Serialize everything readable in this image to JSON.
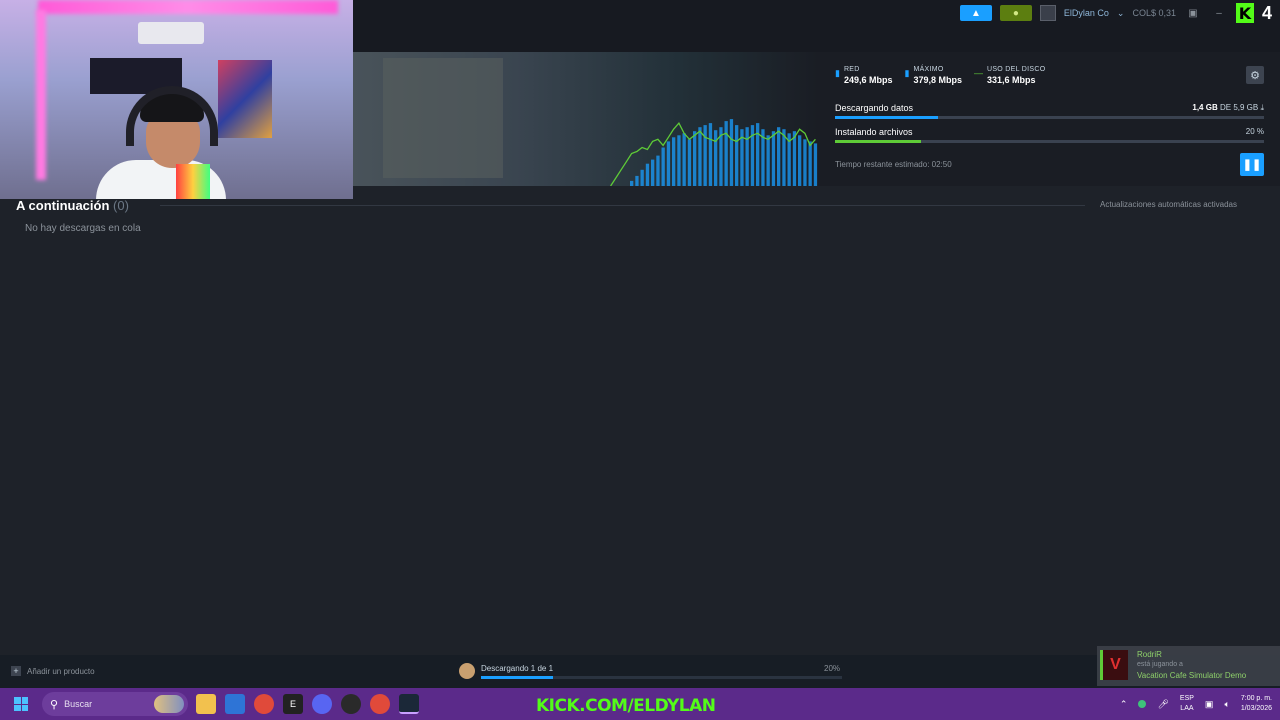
{
  "topbar": {
    "account_name": "ElDylan Co",
    "account_balance": "COL$ 0,31",
    "kick_logo": "K",
    "kick_number": "4"
  },
  "download": {
    "stats": [
      {
        "label": "RED",
        "value": "249,6 Mbps",
        "icon": "network-bars-icon",
        "color": "#1a9fff"
      },
      {
        "label": "MÁXIMO",
        "value": "379,8 Mbps",
        "icon": "peak-bars-icon",
        "color": "#1a9fff"
      },
      {
        "label": "USO DEL DISCO",
        "value": "331,6 Mbps",
        "icon": "disk-line-icon",
        "color": "#5ecb37"
      }
    ],
    "downloading_label": "Descargando datos",
    "downloaded_amount": "1,4 GB",
    "downloaded_of": "DE",
    "total_amount": "5,9 GB",
    "downloaded_fraction": 0.24,
    "installing_label": "Instalando archivos",
    "installing_percent_text": "20 %",
    "installing_fraction": 0.2,
    "time_remaining": "Tiempo restante estimado: 02:50"
  },
  "queue": {
    "title": "A continuación",
    "count": "(0)",
    "auto_updates": "Actualizaciones automáticas activadas",
    "empty_message": "No hay descargas en cola"
  },
  "statusbar": {
    "add_product": "Añadir un producto",
    "downloading_status": "Descargando 1 de 1",
    "percent": "20%",
    "progress_fraction": 0.2
  },
  "friend_toast": {
    "name": "RodriR",
    "status": "está jugando a",
    "game": "Vacation Cafe Simulator Demo"
  },
  "taskbar": {
    "search_placeholder": "Buscar",
    "overlay_text": "KICK.COM/ELDYLAN",
    "language_line1": "ESP",
    "language_line2": "LAA",
    "time": "7:00 p. m.",
    "date": "1/03/2026"
  },
  "graph": {
    "network_bars": [
      0,
      0,
      0,
      0,
      5,
      10,
      16,
      22,
      26,
      30,
      38,
      44,
      48,
      50,
      52,
      46,
      54,
      58,
      60,
      62,
      55,
      58,
      64,
      66,
      60,
      56,
      58,
      60,
      62,
      56,
      50,
      54,
      58,
      56,
      52,
      54,
      50,
      46,
      44,
      42
    ],
    "disk_line": [
      0,
      8,
      16,
      24,
      32,
      34,
      38,
      36,
      44,
      46,
      40,
      48,
      56,
      62,
      52,
      46,
      50,
      54,
      48,
      46,
      44,
      50,
      52,
      46,
      44,
      48,
      46,
      50,
      52,
      48,
      46,
      50,
      54,
      50,
      44,
      48,
      56,
      52,
      40,
      46
    ]
  },
  "colors": {
    "accent": "#1a9fff",
    "disk": "#5ecb37",
    "kick_green": "#53fc18",
    "taskbar": "#5b2a8a"
  }
}
